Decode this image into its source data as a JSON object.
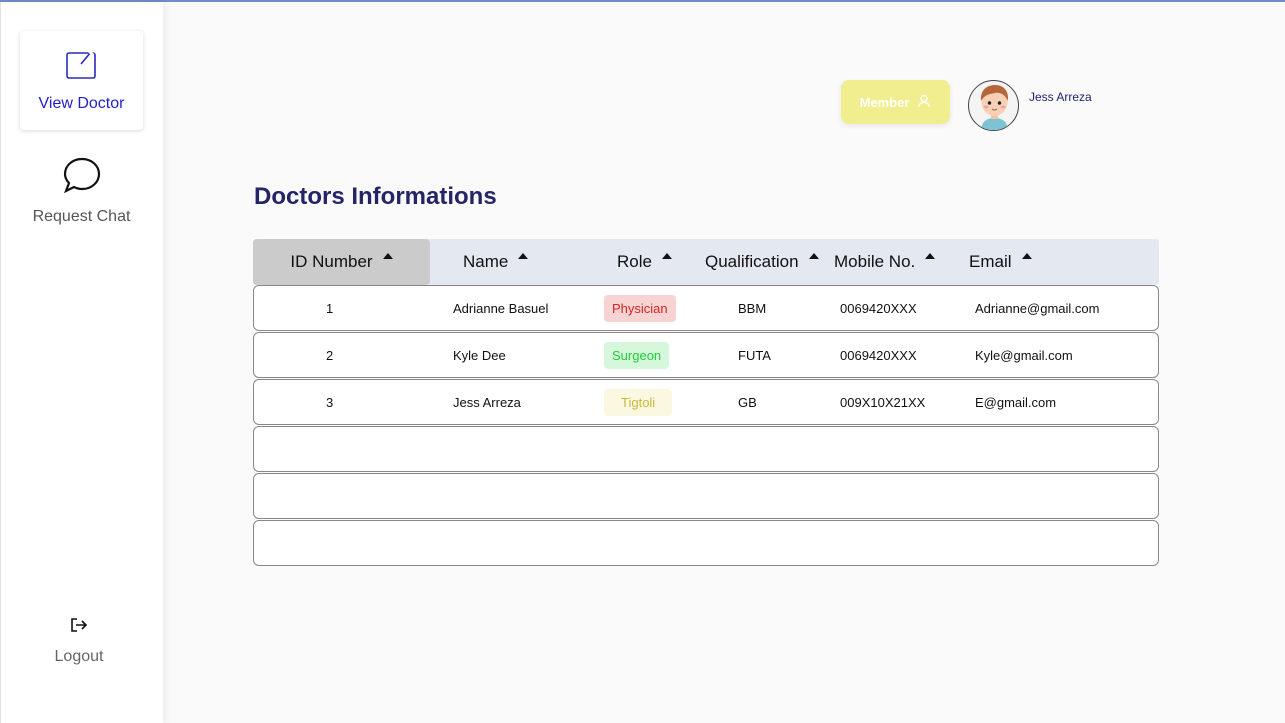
{
  "sidebar": {
    "items": [
      {
        "label": "View Doctor",
        "icon": "edit-square-icon",
        "active": true
      },
      {
        "label": "Request Chat",
        "icon": "chat-bubble-icon",
        "active": false
      }
    ],
    "logout_label": "Logout"
  },
  "header": {
    "member_label": "Member",
    "user_name": "Jess Arreza"
  },
  "page_title": "Doctors Informations",
  "table": {
    "columns": [
      "ID Number",
      "Name",
      "Role",
      "Qualification",
      "Mobile No.",
      "Email"
    ],
    "rows": [
      {
        "id": "1",
        "name": "Adrianne Basuel",
        "role": "Physician",
        "qualification": "BBM",
        "mobile": "0069420XXX",
        "email": "Adrianne@gmail.com"
      },
      {
        "id": "2",
        "name": "Kyle Dee",
        "role": "Surgeon",
        "qualification": "FUTA",
        "mobile": "0069420XXX",
        "email": "Kyle@gmail.com"
      },
      {
        "id": "3",
        "name": "Jess Arreza",
        "role": "Tigtoli",
        "qualification": "GB",
        "mobile": "009X10X21XX",
        "email": "E@gmail.com"
      }
    ],
    "empty_rows": 3
  },
  "colors": {
    "physician_bg": "#f8d3d3",
    "physician_fg": "#d42424",
    "surgeon_bg": "#d5f8dd",
    "surgeon_fg": "#22cc33",
    "tigtoli_bg": "#fbf8e2",
    "tigtoli_fg": "#c9b73a",
    "accent": "#2222cc"
  }
}
